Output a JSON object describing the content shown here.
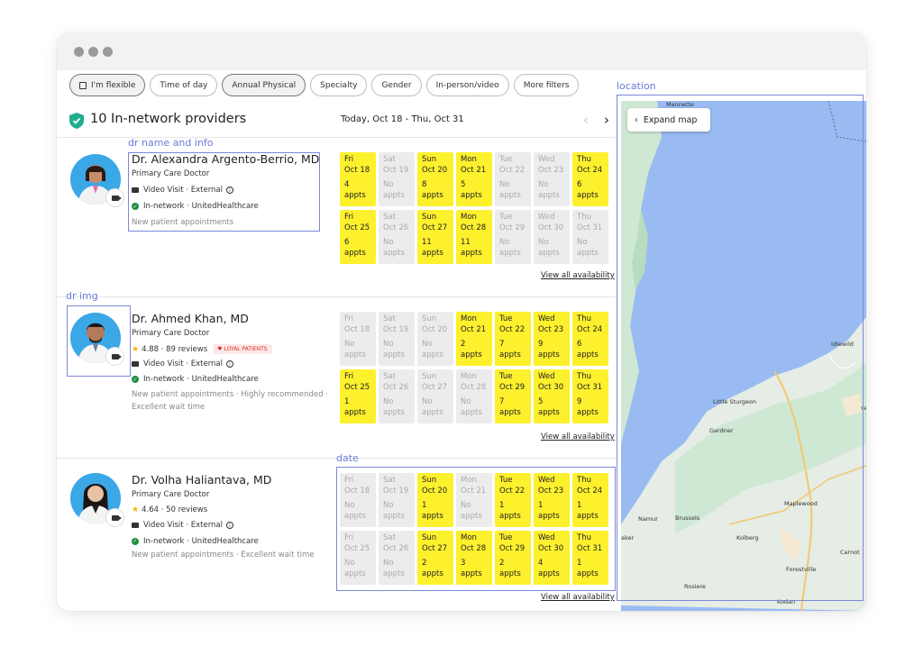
{
  "filters": [
    "I'm flexible",
    "Time of day",
    "Annual Physical",
    "Specialty",
    "Gender",
    "In-person/video",
    "More filters"
  ],
  "header": {
    "providers": "10 In-network providers",
    "date_range": "Today, Oct 18 - Thu, Oct 31",
    "prev": "‹",
    "next": "›"
  },
  "view_all": "View all availability",
  "providers": [
    {
      "name": "Dr. Alexandra Argento-Berrio, MD",
      "specialty": "Primary Care Doctor",
      "visit": "Video Visit · External",
      "network": "In-network · UnitedHealthcare",
      "note": "New patient appointments",
      "days": [
        {
          "d": "Fri",
          "date": "Oct 18",
          "n": "4",
          "u": "appts",
          "on": true
        },
        {
          "d": "Sat",
          "date": "Oct 19",
          "n": "No",
          "u": "appts",
          "on": false
        },
        {
          "d": "Sun",
          "date": "Oct 20",
          "n": "8",
          "u": "appts",
          "on": true
        },
        {
          "d": "Mon",
          "date": "Oct 21",
          "n": "5",
          "u": "appts",
          "on": true
        },
        {
          "d": "Tue",
          "date": "Oct 22",
          "n": "No",
          "u": "appts",
          "on": false
        },
        {
          "d": "Wed",
          "date": "Oct 23",
          "n": "No",
          "u": "appts",
          "on": false
        },
        {
          "d": "Thu",
          "date": "Oct 24",
          "n": "6",
          "u": "appts",
          "on": true
        },
        {
          "d": "Fri",
          "date": "Oct 25",
          "n": "6",
          "u": "appts",
          "on": true
        },
        {
          "d": "Sat",
          "date": "Oct 26",
          "n": "No",
          "u": "appts",
          "on": false
        },
        {
          "d": "Sun",
          "date": "Oct 27",
          "n": "11",
          "u": "appts",
          "on": true
        },
        {
          "d": "Mon",
          "date": "Oct 28",
          "n": "11",
          "u": "appts",
          "on": true
        },
        {
          "d": "Tue",
          "date": "Oct 29",
          "n": "No",
          "u": "appts",
          "on": false
        },
        {
          "d": "Wed",
          "date": "Oct 30",
          "n": "No",
          "u": "appts",
          "on": false
        },
        {
          "d": "Thu",
          "date": "Oct 31",
          "n": "No",
          "u": "appts",
          "on": false
        }
      ]
    },
    {
      "name": "Dr. Ahmed Khan, MD",
      "specialty": "Primary Care Doctor",
      "rating": "4.88 · 89 reviews",
      "badge": "LOYAL PATIENTS",
      "visit": "Video Visit · External",
      "network": "In-network · UnitedHealthcare",
      "note": "New patient appointments · Highly recommended · Excellent wait time",
      "days": [
        {
          "d": "Fri",
          "date": "Oct 18",
          "n": "No",
          "u": "appts",
          "on": false
        },
        {
          "d": "Sat",
          "date": "Oct 19",
          "n": "No",
          "u": "appts",
          "on": false
        },
        {
          "d": "Sun",
          "date": "Oct 20",
          "n": "No",
          "u": "appts",
          "on": false
        },
        {
          "d": "Mon",
          "date": "Oct 21",
          "n": "2",
          "u": "appts",
          "on": true
        },
        {
          "d": "Tue",
          "date": "Oct 22",
          "n": "7",
          "u": "appts",
          "on": true
        },
        {
          "d": "Wed",
          "date": "Oct 23",
          "n": "9",
          "u": "appts",
          "on": true
        },
        {
          "d": "Thu",
          "date": "Oct 24",
          "n": "6",
          "u": "appts",
          "on": true
        },
        {
          "d": "Fri",
          "date": "Oct 25",
          "n": "1",
          "u": "appts",
          "on": true
        },
        {
          "d": "Sat",
          "date": "Oct 26",
          "n": "No",
          "u": "appts",
          "on": false
        },
        {
          "d": "Sun",
          "date": "Oct 27",
          "n": "No",
          "u": "appts",
          "on": false
        },
        {
          "d": "Mon",
          "date": "Oct 28",
          "n": "No",
          "u": "appts",
          "on": false
        },
        {
          "d": "Tue",
          "date": "Oct 29",
          "n": "7",
          "u": "appts",
          "on": true
        },
        {
          "d": "Wed",
          "date": "Oct 30",
          "n": "5",
          "u": "appts",
          "on": true
        },
        {
          "d": "Thu",
          "date": "Oct 31",
          "n": "9",
          "u": "appts",
          "on": true
        }
      ]
    },
    {
      "name": "Dr. Volha Haliantava, MD",
      "specialty": "Primary Care Doctor",
      "rating": "4.64 · 50 reviews",
      "visit": "Video Visit · External",
      "network": "In-network · UnitedHealthcare",
      "note": "New patient appointments · Excellent wait time",
      "days": [
        {
          "d": "Fri",
          "date": "Oct 18",
          "n": "No",
          "u": "appts",
          "on": false
        },
        {
          "d": "Sat",
          "date": "Oct 19",
          "n": "No",
          "u": "appts",
          "on": false
        },
        {
          "d": "Sun",
          "date": "Oct 20",
          "n": "1",
          "u": "appts",
          "on": true
        },
        {
          "d": "Mon",
          "date": "Oct 21",
          "n": "No",
          "u": "appts",
          "on": false
        },
        {
          "d": "Tue",
          "date": "Oct 22",
          "n": "1",
          "u": "appts",
          "on": true
        },
        {
          "d": "Wed",
          "date": "Oct 23",
          "n": "1",
          "u": "appts",
          "on": true
        },
        {
          "d": "Thu",
          "date": "Oct 24",
          "n": "1",
          "u": "appts",
          "on": true
        },
        {
          "d": "Fri",
          "date": "Oct 25",
          "n": "No",
          "u": "appts",
          "on": false
        },
        {
          "d": "Sat",
          "date": "Oct 26",
          "n": "No",
          "u": "appts",
          "on": false
        },
        {
          "d": "Sun",
          "date": "Oct 27",
          "n": "2",
          "u": "appts",
          "on": true
        },
        {
          "d": "Mon",
          "date": "Oct 28",
          "n": "3",
          "u": "appts",
          "on": true
        },
        {
          "d": "Tue",
          "date": "Oct 29",
          "n": "2",
          "u": "appts",
          "on": true
        },
        {
          "d": "Wed",
          "date": "Oct 30",
          "n": "4",
          "u": "appts",
          "on": true
        },
        {
          "d": "Thu",
          "date": "Oct 31",
          "n": "1",
          "u": "appts",
          "on": true
        }
      ]
    }
  ],
  "map": {
    "expand": "Expand map",
    "labels": [
      "Mannette",
      "Idlewild",
      "Little Sturgeon",
      "Gardner",
      "Maplewood",
      "Namur",
      "Brussels",
      "Kolberg",
      "Carnot",
      "Forestville",
      "Rosiere",
      "Kodan",
      "aker",
      "se"
    ]
  },
  "annotations": [
    "dr name and info",
    "dr img",
    "date",
    "location"
  ],
  "colors": {
    "available": "#fdf02d",
    "unavailable": "#ececec",
    "water": "#99bbf2",
    "land": "#cfe8d4",
    "annotation": "#7c88d8"
  }
}
